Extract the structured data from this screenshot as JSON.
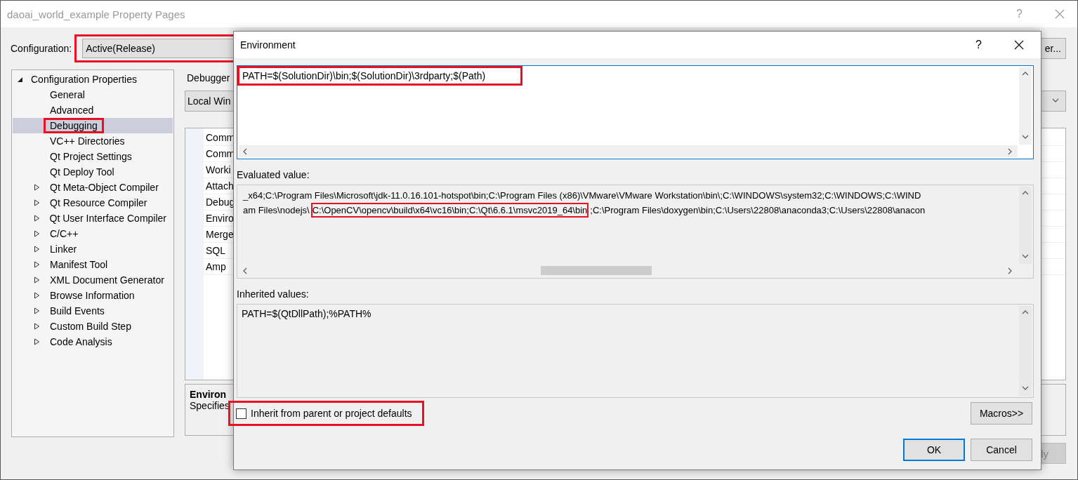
{
  "window": {
    "title": "daoai_world_example Property Pages",
    "help": "?"
  },
  "configuration": {
    "label": "Configuration:",
    "value": "Active(Release)",
    "highlighted": true
  },
  "side_button": {
    "label": "er..."
  },
  "tree": [
    {
      "label": "Configuration Properties",
      "expanded": true,
      "selected": false,
      "children": [
        {
          "label": "General",
          "expandable": false,
          "selected": false,
          "highlighted": false
        },
        {
          "label": "Advanced",
          "expandable": false,
          "selected": false,
          "highlighted": false
        },
        {
          "label": "Debugging",
          "expandable": false,
          "selected": true,
          "highlighted": true
        },
        {
          "label": "VC++ Directories",
          "expandable": false,
          "selected": false,
          "highlighted": false
        },
        {
          "label": "Qt Project Settings",
          "expandable": false,
          "selected": false,
          "highlighted": false
        },
        {
          "label": "Qt Deploy Tool",
          "expandable": false,
          "selected": false,
          "highlighted": false
        },
        {
          "label": "Qt Meta-Object Compiler",
          "expandable": true,
          "selected": false,
          "highlighted": false
        },
        {
          "label": "Qt Resource Compiler",
          "expandable": true,
          "selected": false,
          "highlighted": false
        },
        {
          "label": "Qt User Interface Compiler",
          "expandable": true,
          "selected": false,
          "highlighted": false
        },
        {
          "label": "C/C++",
          "expandable": true,
          "selected": false,
          "highlighted": false
        },
        {
          "label": "Linker",
          "expandable": true,
          "selected": false,
          "highlighted": false
        },
        {
          "label": "Manifest Tool",
          "expandable": true,
          "selected": false,
          "highlighted": false
        },
        {
          "label": "XML Document Generator",
          "expandable": true,
          "selected": false,
          "highlighted": false
        },
        {
          "label": "Browse Information",
          "expandable": true,
          "selected": false,
          "highlighted": false
        },
        {
          "label": "Build Events",
          "expandable": true,
          "selected": false,
          "highlighted": false
        },
        {
          "label": "Custom Build Step",
          "expandable": true,
          "selected": false,
          "highlighted": false
        },
        {
          "label": "Code Analysis",
          "expandable": true,
          "selected": false,
          "highlighted": false
        }
      ]
    }
  ],
  "debugger": {
    "label": "Debugger",
    "value": "Local Win"
  },
  "property_rows": [
    "Comm",
    "Comm",
    "Worki",
    "Attach",
    "Debug",
    "Enviro",
    "Merge",
    "SQL",
    "Amp"
  ],
  "description": {
    "title": "Environ",
    "text": "Specifies"
  },
  "apply_button": {
    "label": "ly"
  },
  "dialog": {
    "title": "Environment",
    "help": "?",
    "environment_value": {
      "text": "PATH=$(SolutionDir)\\bin;$(SolutionDir)\\3rdparty;$(Path)",
      "highlighted": true
    },
    "evaluated_label": "Evaluated value:",
    "evaluated_lines": [
      [
        {
          "text": "_x64;C:\\Program Files\\Microsoft\\jdk-11.0.16.101-hotspot\\bin;C:\\Program Files (x86)\\VMware\\VMware Workstation\\bin\\;C:\\WINDOWS\\system32;C:\\WINDOWS;C:\\WIND",
          "highlighted": false
        }
      ],
      [
        {
          "text": "am Files\\nodejs\\",
          "highlighted": false
        },
        {
          "text": "C:\\OpenCV\\opencv\\build\\x64\\vc16\\bin;C:\\Qt\\6.6.1\\msvc2019_64\\bin",
          "highlighted": true
        },
        {
          "text": ";C:\\Program Files\\doxygen\\bin;C:\\Users\\22808\\anaconda3;C:\\Users\\22808\\anacon",
          "highlighted": false
        }
      ]
    ],
    "inherited_label": "Inherited values:",
    "inherited_value": "PATH=$(QtDllPath);%PATH%",
    "inherit_checkbox": {
      "label": "Inherit from parent or project defaults",
      "checked": false,
      "highlighted": true
    },
    "macros_button": {
      "label": "Macros>>"
    },
    "ok_button": {
      "label": "OK",
      "default": true
    },
    "cancel_button": {
      "label": "Cancel",
      "default": false
    }
  }
}
